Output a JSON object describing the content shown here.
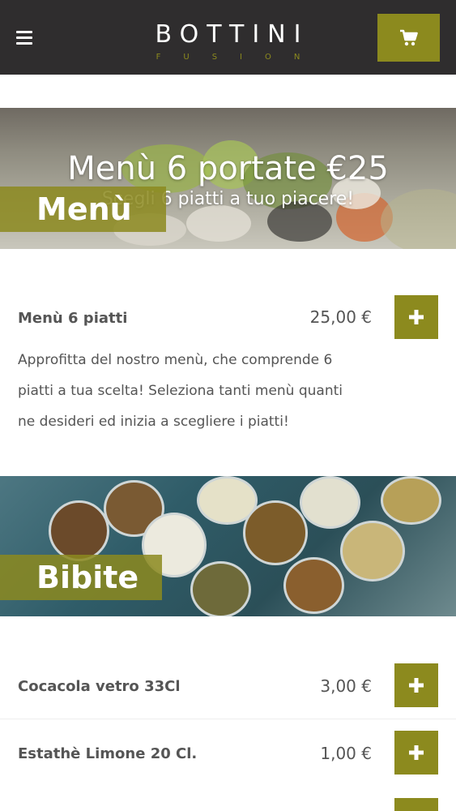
{
  "header": {
    "logo_main": "BOTTINI",
    "logo_sub": "FUSION",
    "menu_icon": "hamburger-icon",
    "cart_icon": "cart-icon"
  },
  "sections": {
    "menu": {
      "banner_title": "Menù 6 portate €25",
      "banner_subtitle": "Scegli 6 piatti a tuo piacere!",
      "label": "Menù",
      "items": [
        {
          "name": "Menù 6 piatti",
          "price": "25,00 €",
          "description": "Approfitta del nostro menù, che comprende 6 piatti a tua scelta! Seleziona tanti menù quanti ne desideri ed inizia a scegliere i piatti!"
        }
      ]
    },
    "bibite": {
      "label": "Bibite",
      "items": [
        {
          "name": "Cocacola vetro 33Cl",
          "price": "3,00 €"
        },
        {
          "name": "Estathè Limone 20 Cl.",
          "price": "1,00 €"
        }
      ]
    }
  },
  "colors": {
    "header_bg": "#2f2d2e",
    "accent": "#8c8a1e",
    "text": "#555555"
  },
  "icons": {
    "add": "plus-icon"
  }
}
